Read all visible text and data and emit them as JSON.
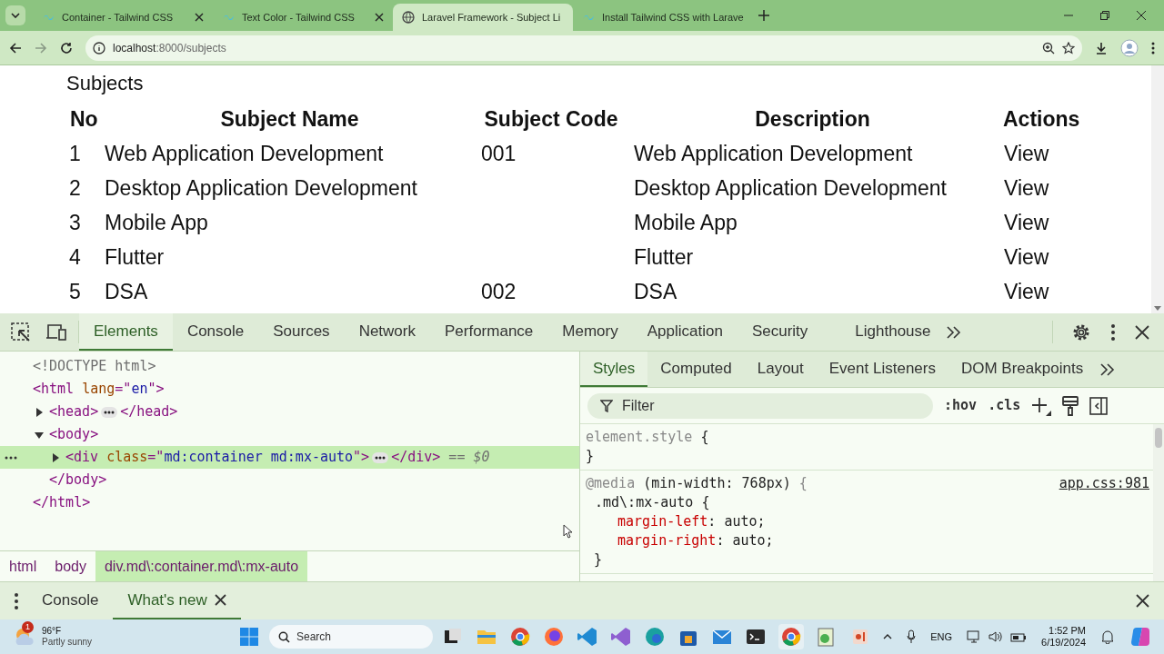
{
  "browser": {
    "tabs": [
      {
        "title": "Container - Tailwind CSS",
        "selected": false
      },
      {
        "title": "Text Color - Tailwind CSS",
        "selected": false
      },
      {
        "title": "Laravel Framework - Subject Li",
        "selected": true
      },
      {
        "title": "Install Tailwind CSS with Larave",
        "selected": false
      }
    ],
    "address": {
      "host": "localhost",
      "path": ":8000/subjects"
    }
  },
  "page": {
    "heading": "Subjects",
    "columns": [
      "No",
      "Subject Name",
      "Subject Code",
      "Description",
      "Actions"
    ],
    "rows": [
      {
        "no": "1",
        "name": "Web Application Development",
        "code": "001",
        "description": "Web Application Development",
        "action": "View"
      },
      {
        "no": "2",
        "name": "Desktop Application Development",
        "description": "Desktop Application Development",
        "action": "View"
      },
      {
        "no": "3",
        "name": "Mobile App",
        "description": "Mobile App",
        "action": "View"
      },
      {
        "no": "4",
        "name": "Flutter",
        "description": "Flutter",
        "action": "View"
      },
      {
        "no": "5",
        "name": "DSA",
        "code": "002",
        "description": "DSA",
        "action": "View"
      }
    ]
  },
  "devtools": {
    "tabs": [
      {
        "label": "Elements",
        "selected": true
      },
      {
        "label": "Console",
        "selected": false
      },
      {
        "label": "Sources",
        "selected": false
      },
      {
        "label": "Network",
        "selected": false
      },
      {
        "label": "Performance",
        "selected": false
      },
      {
        "label": "Memory",
        "selected": false
      },
      {
        "label": "Application",
        "selected": false
      },
      {
        "label": "Security",
        "selected": false
      },
      {
        "label": "Lighthouse",
        "selected": false
      }
    ],
    "dom": [
      {
        "kind": "doctype",
        "selected": false,
        "tokens": [
          {
            "kind": "doctype",
            "text": "<!DOCTYPE html>"
          }
        ]
      },
      {
        "kind": "root",
        "selected": false,
        "tokens": [
          {
            "kind": "tag",
            "text": "<html"
          },
          {
            "kind": "attr",
            "text": " lang"
          },
          {
            "kind": "tag",
            "text": "=\""
          },
          {
            "kind": "value",
            "text": "en"
          },
          {
            "kind": "tag",
            "text": "\">"
          }
        ],
        "close": "</html>",
        "children": [
          {
            "kind": "element",
            "expanded": false,
            "selected": false,
            "tokens": [
              {
                "kind": "tag",
                "text": "<head>"
              },
              {
                "kind": "dots"
              },
              {
                "kind": "tag",
                "text": "</head>"
              }
            ]
          },
          {
            "kind": "element",
            "expanded": true,
            "selected": false,
            "tokens": [
              {
                "kind": "tag",
                "text": "<body>"
              }
            ],
            "close": "</body>",
            "children": [
              {
                "kind": "element",
                "expanded": false,
                "selected": true,
                "tokens": [
                  {
                    "kind": "tag",
                    "text": "<div"
                  },
                  {
                    "kind": "attr",
                    "text": " class"
                  },
                  {
                    "kind": "tag",
                    "text": "=\""
                  },
                  {
                    "kind": "value",
                    "text": "md:container md:mx-auto"
                  },
                  {
                    "kind": "tag",
                    "text": "\">"
                  },
                  {
                    "kind": "dots"
                  },
                  {
                    "kind": "tag",
                    "text": "</div>"
                  },
                  {
                    "kind": "marker",
                    "text": " == $0"
                  }
                ]
              }
            ]
          }
        ]
      }
    ],
    "breadcrumbs": [
      {
        "label": "html",
        "selected": false
      },
      {
        "label": "body",
        "selected": false
      },
      {
        "label": "div.md\\:container.md\\:mx-auto",
        "selected": true
      }
    ],
    "side_tabs": [
      {
        "label": "Styles",
        "selected": true
      },
      {
        "label": "Computed",
        "selected": false
      },
      {
        "label": "Layout",
        "selected": false
      },
      {
        "label": "Event Listeners",
        "selected": false
      },
      {
        "label": "DOM Breakpoints",
        "selected": false
      }
    ],
    "filter": {
      "placeholder": "Filter"
    },
    "tools": [
      ":hov",
      ".cls"
    ],
    "rules": [
      {
        "selector": "element.style",
        "selector_muted": true,
        "open": " {",
        "close": "}"
      },
      {
        "media": "@media",
        "media_query": " (min-width: 768px)",
        "media_open": " {",
        "source": "app.css:981",
        "selector": ".md\\:mx-auto",
        "selector_muted": false,
        "open": " {",
        "close": " }",
        "props": [
          {
            "name": "margin-left",
            "colon": ":",
            "value": "auto",
            "end": ";"
          },
          {
            "name": "margin-right",
            "colon": ":",
            "value": "auto",
            "end": ";"
          }
        ]
      }
    ],
    "drawer_tabs": [
      {
        "label": "Console",
        "selected": false,
        "closable": false
      },
      {
        "label": "What's new",
        "selected": true,
        "closable": true
      }
    ]
  },
  "taskbar": {
    "weather": {
      "badge": "1",
      "temp": "96°F",
      "condition": "Partly sunny"
    },
    "search": {
      "placeholder": "Search"
    },
    "language": "ENG",
    "time": "1:52 PM",
    "date": "6/19/2024"
  }
}
